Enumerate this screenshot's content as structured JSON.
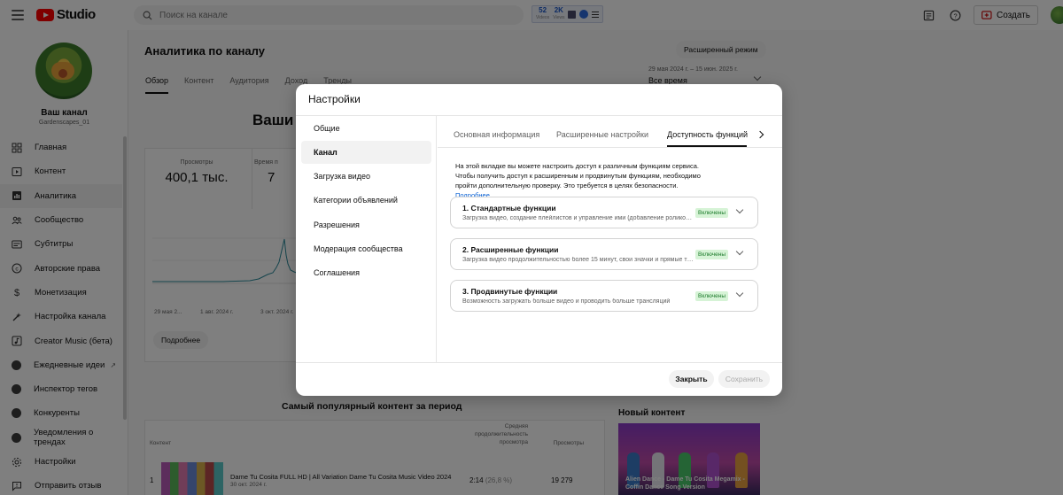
{
  "app": {
    "logo_text": "Studio",
    "search_placeholder": "Поиск на канале",
    "ext_stats": [
      {
        "value": "52",
        "label": "Videos"
      },
      {
        "value": "2K",
        "label": "Views"
      }
    ],
    "create_label": "Создать"
  },
  "channel": {
    "name": "Ваш канал",
    "handle": "Gardenscapes_01"
  },
  "sidebar": {
    "items": [
      {
        "label": "Главная",
        "icon": "dashboard-icon"
      },
      {
        "label": "Контент",
        "icon": "content-icon"
      },
      {
        "label": "Аналитика",
        "icon": "analytics-icon",
        "active": true
      },
      {
        "label": "Сообщество",
        "icon": "community-icon"
      },
      {
        "label": "Субтитры",
        "icon": "subtitles-icon"
      },
      {
        "label": "Авторские права",
        "icon": "copyright-icon"
      },
      {
        "label": "Монетизация",
        "icon": "monetization-icon"
      },
      {
        "label": "Настройка канала",
        "icon": "customization-icon"
      },
      {
        "label": "Creator Music (бета)",
        "icon": "creator-music-icon"
      },
      {
        "label": "Ежедневные идеи",
        "icon": "ext-daily-ideas-icon"
      },
      {
        "label": "Инспектор тегов",
        "icon": "ext-tag-inspector-icon"
      },
      {
        "label": "Конкуренты",
        "icon": "ext-competitors-icon"
      },
      {
        "label": "Уведомления о трендах",
        "icon": "ext-trend-alerts-icon"
      },
      {
        "label": "Настройки",
        "icon": "settings-icon"
      },
      {
        "label": "Отправить отзыв",
        "icon": "feedback-icon"
      }
    ]
  },
  "analytics": {
    "title": "Аналитика по каналу",
    "advanced_button": "Расширенный режим",
    "tabs": [
      "Обзор",
      "Контент",
      "Аудитория",
      "Доход",
      "Тренды"
    ],
    "date_range": "29 мая 2024 г. – 15 июн. 2025 г.",
    "date_select": "Все время",
    "big_title": "Ваши в",
    "metrics": [
      {
        "label": "Просмотры",
        "value": "400,1 тыс."
      },
      {
        "label": "Время п",
        "value": "7"
      }
    ],
    "chart_x_labels": [
      "29 мая 2...",
      "1 авг. 2024 г.",
      "3 окт. 2024 г."
    ],
    "more_button": "Подробнее",
    "popular_title": "Самый популярный контент за период",
    "table_headers": {
      "content": "Контент",
      "avg_duration": "Средняя продолжительность просмотра",
      "views": "Просмотры"
    },
    "top_video": {
      "rank": "1",
      "title": "Dame Tu Cosita FULL HD | All Variation Dame Tu Cosita Music Video 2024",
      "date": "30 окт. 2024 г.",
      "duration": "2:14",
      "duration_pct": "(26,8 %)",
      "views": "19 279"
    },
    "new_content_title": "Новый контент",
    "new_content_caption": "Alien Dance - Dame Tu Cosita Megamix - Coffin Dance Song Version"
  },
  "modal": {
    "title": "Настройки",
    "side_items": [
      "Общие",
      "Канал",
      "Загрузка видео",
      "Категории объявлений",
      "Разрешения",
      "Модерация сообщества",
      "Соглашения"
    ],
    "active_side": "Канал",
    "tabs": [
      "Основная информация",
      "Расширенные настройки",
      "Доступность функций"
    ],
    "active_tab": "Доступность функций",
    "description": "На этой вкладке вы можете настроить доступ к различным функциям сервиса. Чтобы получить доступ к расширенным и продвинутым функциям, необходимо пройти дополнительную проверку. Это требуется в целях безопасности.",
    "description_link": "Подробнее...",
    "features": [
      {
        "name": "1. Стандартные функции",
        "desc": "Загрузка видео, создание плейлистов и управление ими (добавление роликов и т. д.)",
        "status": "Включены"
      },
      {
        "name": "2. Расширенные функции",
        "desc": "Загрузка видео продолжительностью более 15 минут, свои значки и прямые трансляции",
        "status": "Включены"
      },
      {
        "name": "3. Продвинутые функции",
        "desc": "Возможность загружать больше видео и проводить больше трансляций",
        "status": "Включены"
      }
    ],
    "close_button": "Закрыть",
    "save_button": "Сохранить"
  }
}
